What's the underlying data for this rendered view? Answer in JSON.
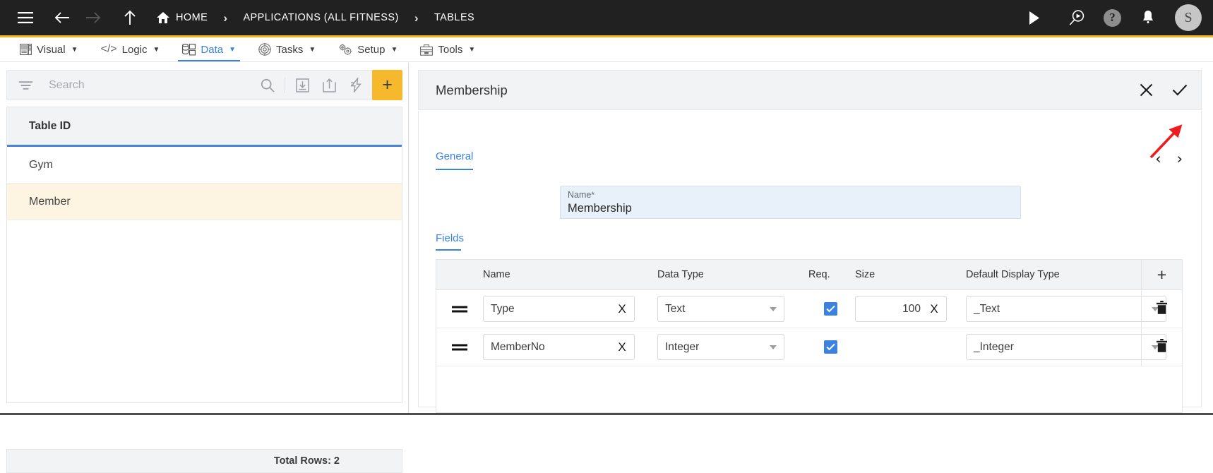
{
  "topbar": {
    "menu_icon": "hamburger-icon",
    "back_icon": "arrow-back-icon",
    "forward_icon": "arrow-forward-icon",
    "up_icon": "arrow-up-icon",
    "breadcrumb": [
      {
        "label": "HOME",
        "icon": "home-icon"
      },
      {
        "label": "APPLICATIONS (ALL FITNESS)",
        "icon": ""
      },
      {
        "label": "TABLES",
        "icon": ""
      }
    ],
    "separator": "›",
    "actions": [
      {
        "name": "run-icon",
        "label": ""
      },
      {
        "name": "preview-search-icon",
        "label": ""
      },
      {
        "name": "help-icon",
        "label": "?"
      },
      {
        "name": "notifications-bell-icon",
        "label": ""
      }
    ],
    "avatar_initial": "S",
    "accent_color": "#f6b425",
    "background_color": "#212121"
  },
  "menubar": {
    "items": [
      {
        "label": "Visual",
        "icon": "visual-icon",
        "active": false
      },
      {
        "label": "Logic",
        "icon": "code-icon",
        "active": false
      },
      {
        "label": "Data",
        "icon": "database-icon",
        "active": true
      },
      {
        "label": "Tasks",
        "icon": "tasks-icon",
        "active": false
      },
      {
        "label": "Setup",
        "icon": "gears-icon",
        "active": false
      },
      {
        "label": "Tools",
        "icon": "toolbox-icon",
        "active": false
      }
    ],
    "caret": "▼",
    "active_color": "#3b82e0"
  },
  "left_panel": {
    "toolbar": {
      "filter_icon": "filter-icon",
      "search_value": "",
      "search_placeholder": "Search",
      "search_icon": "search-icon",
      "import_icon": "import-icon",
      "export_icon": "export-icon",
      "bolt_icon": "lightning-bolt-icon",
      "add_label": "+",
      "add_color": "#f6b92e"
    },
    "column_header": "Table ID",
    "rows": [
      {
        "name": "Gym",
        "selected": false
      },
      {
        "name": "Member",
        "selected": true
      }
    ],
    "footer": "Total Rows: 2",
    "selected_row_color": "#fdf4e1",
    "header_underline_color": "#4a86d4"
  },
  "right_panel": {
    "title": "Membership",
    "close_icon": "close-icon",
    "confirm_icon": "check-icon",
    "tab": "General",
    "prev_icon": "‹",
    "next_icon": "›",
    "name_field": {
      "label": "Name",
      "required_marker": "*",
      "value": "Membership"
    },
    "fields_section_label": "Fields",
    "fields_table": {
      "columns": [
        "Name",
        "Data Type",
        "Req.",
        "Size",
        "Default Display Type"
      ],
      "add_row_label": "+",
      "delete_icon": "trash-icon",
      "drag_icon": "drag-handle-icon",
      "clear_icon": "X",
      "rows": [
        {
          "name": "Type",
          "data_type": "Text",
          "required": true,
          "size": "100",
          "default_display_type": "_Text",
          "has_size": true
        },
        {
          "name": "MemberNo",
          "data_type": "Integer",
          "required": true,
          "size": "",
          "default_display_type": "_Integer",
          "has_size": false
        }
      ]
    }
  },
  "annotation": {
    "type": "red-arrow",
    "color": "#ee1c1c",
    "points_to": "next-record-button"
  }
}
